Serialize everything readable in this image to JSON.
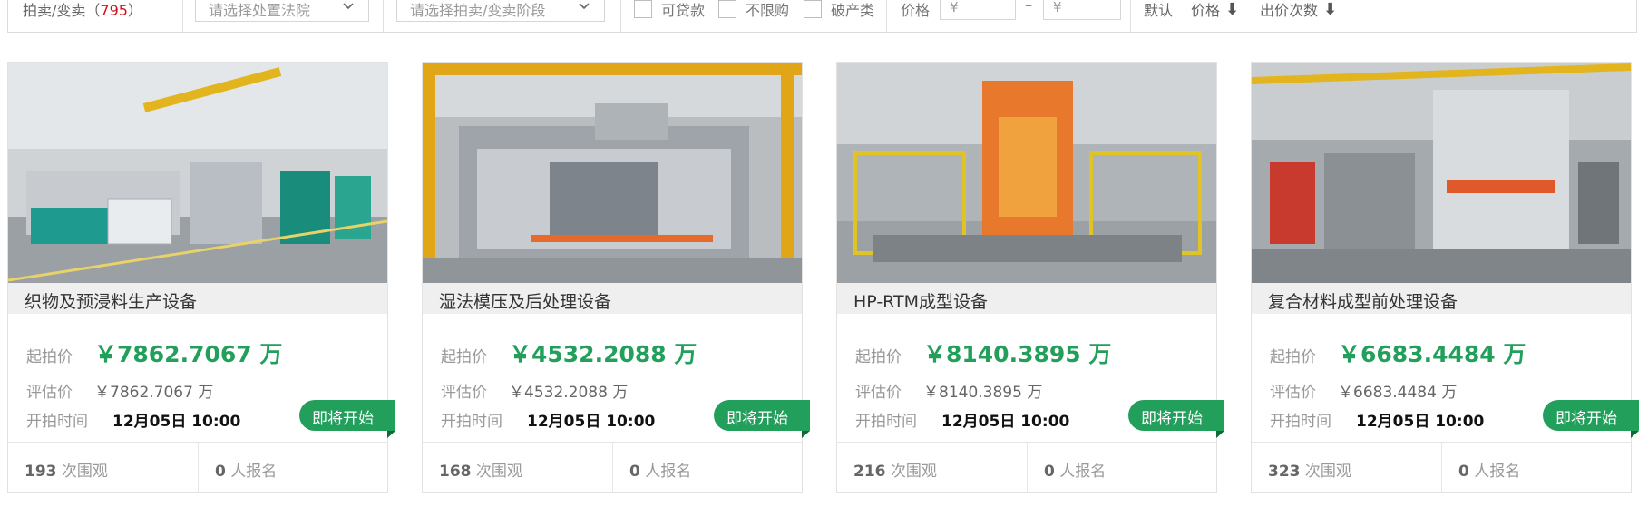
{
  "filter": {
    "count_label": "拍卖/变卖（",
    "count_value": "795",
    "count_close": "）",
    "court_placeholder": "请选择处置法院",
    "stage_placeholder": "请选择拍卖/变卖阶段",
    "checkboxes": [
      "可贷款",
      "不限购",
      "破产类"
    ],
    "price_label": "价格",
    "currency_symbol": "¥",
    "range_dash": "–",
    "sort_default": "默认",
    "sort_price": "价格",
    "sort_bids": "出价次数",
    "sort_arrow": "⬇"
  },
  "labels": {
    "start_price": "起拍价",
    "eval_price": "评估价",
    "start_time": "开拍时间",
    "status_badge": "即将开始",
    "views_suffix": "次围观",
    "signup_suffix": "人报名"
  },
  "cards": [
    {
      "title": "织物及预浸料生产设备",
      "start_price": "￥7862.7067 万",
      "eval_price": "￥7862.7067 万",
      "start_time": "12月05日 10:00",
      "views": "193",
      "signups": "0"
    },
    {
      "title": "湿法模压及后处理设备",
      "start_price": "￥4532.2088 万",
      "eval_price": "￥4532.2088 万",
      "start_time": "12月05日 10:00",
      "views": "168",
      "signups": "0"
    },
    {
      "title": "HP-RTM成型设备",
      "start_price": "￥8140.3895 万",
      "eval_price": "￥8140.3895 万",
      "start_time": "12月05日 10:00",
      "views": "216",
      "signups": "0"
    },
    {
      "title": "复合材料成型前处理设备",
      "start_price": "￥6683.4484 万",
      "eval_price": "￥6683.4484 万",
      "start_time": "12月05日 10:00",
      "views": "323",
      "signups": "0"
    }
  ],
  "colors": {
    "accent_green": "#22a05b",
    "count_red": "#d0121b"
  }
}
